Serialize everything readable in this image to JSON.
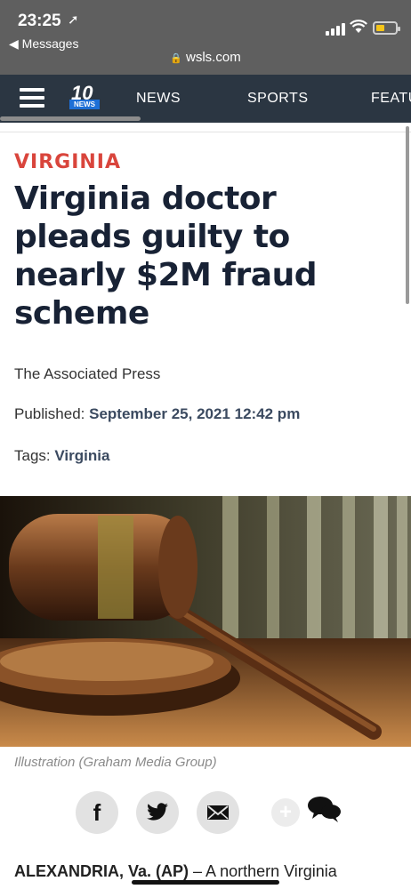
{
  "status_bar": {
    "time": "23:25",
    "location_arrow": "➚",
    "back_label": "◀ Messages",
    "url": "wsls.com"
  },
  "nav": {
    "logo_number": "10",
    "logo_tag": "NEWS",
    "items": [
      "NEWS",
      "SPORTS",
      "FEATU"
    ]
  },
  "article": {
    "kicker": "VIRGINIA",
    "headline": "Virginia doctor pleads guilty to nearly $2M fraud scheme",
    "author": "The Associated Press",
    "published_label": "Published:",
    "published_value": "September 25, 2021 12:42 pm",
    "tags_label": "Tags:",
    "tags_value": "Virginia",
    "photo_caption": "Illustration (Graham Media Group)",
    "lede_dateline": "ALEXANDRIA, Va. (AP)",
    "lede_text": " – A northern Virginia"
  },
  "share": {
    "facebook_glyph": "f",
    "plus_glyph": "+"
  },
  "colors": {
    "kicker": "#d9453c",
    "nav_bg": "#2b3642",
    "headline": "#182235"
  }
}
